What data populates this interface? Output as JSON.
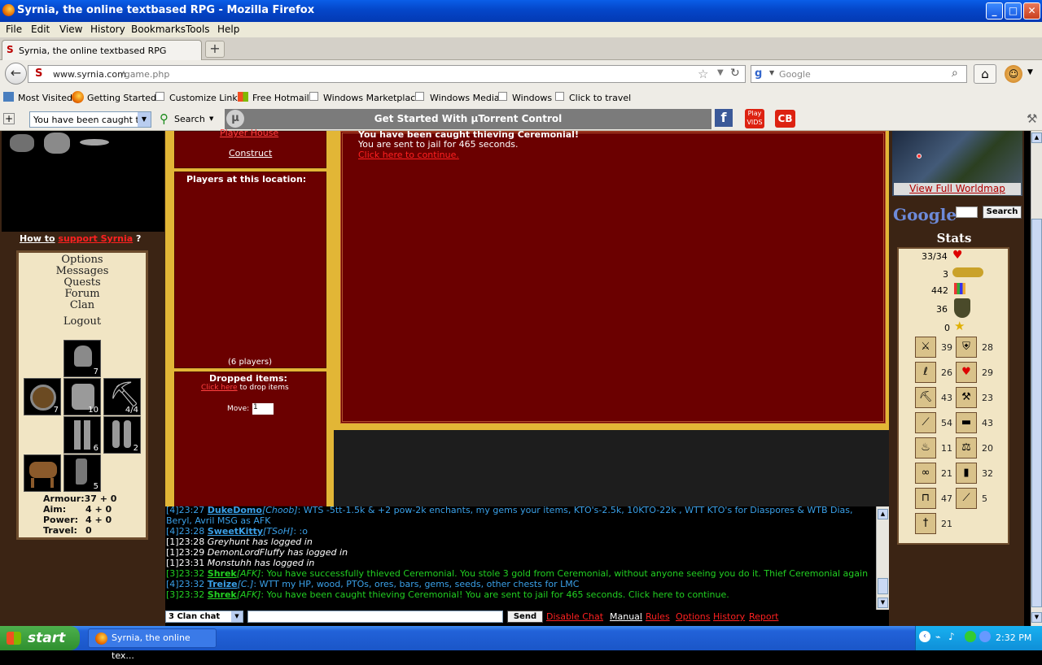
{
  "window": {
    "title": "Syrnia, the online textbased RPG - Mozilla Firefox"
  },
  "menu": [
    "File",
    "Edit",
    "View",
    "History",
    "Bookmarks",
    "Tools",
    "Help"
  ],
  "tab": {
    "label": "Syrnia, the online textbased RPG"
  },
  "nav": {
    "url_host": "www.syrnia.com",
    "url_path": "/game.php",
    "search_placeholder": "Google"
  },
  "bookmarks": [
    "Most Visited",
    "Getting Started",
    "Customize Links",
    "Free Hotmail",
    "Windows Marketplace",
    "Windows Media",
    "Windows",
    "Click to travel"
  ],
  "toolbar2": {
    "dropdown_value": "You have been caught thie",
    "search_label": "Search",
    "utorrent_label": "Get Started With µTorrent Control"
  },
  "left": {
    "support_prefix": "How to",
    "support_link": "support Syrnia",
    "support_suffix": "?",
    "menu": [
      "Options",
      "Messages",
      "Quests",
      "Forum",
      "Clan",
      "Logout"
    ],
    "slots": {
      "helmet": "7",
      "shield": "7",
      "armor": "10",
      "pickaxe": "4/4",
      "legs": "6",
      "gloves": "2",
      "boots": "5"
    },
    "armor_label": "Armour:",
    "armor_value": "37 + 0",
    "aim_label": "Aim:",
    "aim_value": "4 + 0",
    "power_label": "Power:",
    "power_value": "4 + 0",
    "travel_label": "Travel:",
    "travel_value": "0"
  },
  "mid": {
    "player_house": "Player House",
    "construct": "Construct",
    "players_title": "Players at this location:",
    "players_count": "(6 players)",
    "dropped_title": "Dropped items:",
    "click_here": "Click here",
    "drop_text": " to drop items",
    "move_label": "Move:",
    "move_value": "1"
  },
  "main": {
    "caught_line": "You have been caught thieving Ceremonial!",
    "jail_line": "You are sent to jail for 465 seconds.",
    "continue_link": "Click here to continue."
  },
  "chat": {
    "lines": [
      {
        "time": "[4]23:27 ",
        "name": "DukeDomo",
        "tag": "[Choob]",
        "msg": ": WTS -5tt-1.5k & +2 pow-2k enchants, my gems your items, KTO's-2.5k, 10KTO-22k , WTT KTO's for Diaspores & WTB Dias, Beryl, Avril MSG as AFK",
        "color": "#3aa0e8"
      },
      {
        "time": "[4]23:28 ",
        "name": "SweetKitty",
        "tag": "[TSoH]",
        "msg": ": :o",
        "color": "#3aa0e8"
      },
      {
        "time": "[1]23:28 ",
        "name": "",
        "tag": "",
        "msg": "Greyhunt has logged in",
        "color": "#ffffff"
      },
      {
        "time": "[1]23:29 ",
        "name": "",
        "tag": "",
        "msg": "DemonLordFluffy has logged in",
        "color": "#ffffff"
      },
      {
        "time": "[1]23:31 ",
        "name": "",
        "tag": "",
        "msg": "Monstuhh has logged in",
        "color": "#ffffff"
      },
      {
        "time": "[3]23:32 ",
        "name": "Shrek",
        "tag": "[AFK]",
        "msg": ": You have successfully thieved Ceremonial. You stole 3 gold from Ceremonial, without anyone seeing you do it. Thief Ceremonial again",
        "color": "#22d022"
      },
      {
        "time": "[4]23:32 ",
        "name": "Treize",
        "tag": "[C.]",
        "msg": ": WTT my HP, wood, PTOs, ores, bars, gems, seeds, other chests for LMC",
        "color": "#3aa0e8"
      },
      {
        "time": "[3]23:32 ",
        "name": "Shrek",
        "tag": "[AFK]",
        "msg": ": You have been caught thieving Ceremonial! You are sent to jail for 465 seconds. Click here to continue.",
        "color": "#22d022"
      }
    ],
    "channel": "3 Clan chat",
    "send": "Send",
    "links": [
      "Disable Chat",
      "Manual",
      "Rules",
      "Options",
      "History",
      "Report"
    ]
  },
  "right": {
    "worldmap_link": "View Full Worldmap",
    "google_logo": "Google",
    "google_search": "Search",
    "stats_title": "Stats",
    "hp": "33/34",
    "gold": "3",
    "level": "442",
    "combat": "36",
    "quest": "0",
    "skills": [
      {
        "icon": "attack",
        "value": "39"
      },
      {
        "icon": "defence",
        "value": "28"
      },
      {
        "icon": "strength",
        "value": "26"
      },
      {
        "icon": "health",
        "value": "29"
      },
      {
        "icon": "mining",
        "value": "43"
      },
      {
        "icon": "smithing",
        "value": "23"
      },
      {
        "icon": "woodcutting",
        "value": "54"
      },
      {
        "icon": "construction",
        "value": "43"
      },
      {
        "icon": "cooking",
        "value": "11"
      },
      {
        "icon": "trading",
        "value": "20"
      },
      {
        "icon": "thieving",
        "value": "21"
      },
      {
        "icon": "speed",
        "value": "32"
      },
      {
        "icon": "farming",
        "value": "47"
      },
      {
        "icon": "fishing",
        "value": "5"
      },
      {
        "icon": "magic",
        "value": "21"
      }
    ]
  },
  "taskbar": {
    "start": "start",
    "item": "Syrnia, the online tex...",
    "clock": "2:32 PM"
  }
}
